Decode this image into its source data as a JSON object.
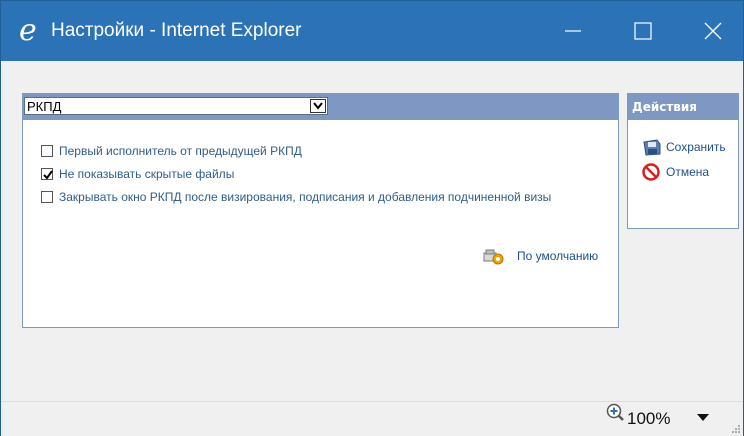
{
  "window": {
    "title": "Настройки - Internet Explorer",
    "title_icon": "ie-logo-icon",
    "controls": [
      "minimize-icon",
      "maximize-icon",
      "close-icon"
    ]
  },
  "main": {
    "select": {
      "value": "РКПД"
    },
    "options": [
      {
        "label": "Первый исполнитель от предыдущей РКПД",
        "checked": false
      },
      {
        "label": "Не показывать скрытые файлы",
        "checked": true
      },
      {
        "label": "Закрывать окно РКПД после визирования, подписания и добавления подчиненной визы",
        "checked": false
      }
    ],
    "default_link": "По умолчанию"
  },
  "actions": {
    "header": "Действия",
    "items": [
      {
        "label": "Сохранить",
        "icon": "save-icon"
      },
      {
        "label": "Отмена",
        "icon": "cancel-icon"
      }
    ]
  },
  "status": {
    "zoom": "100%",
    "zoom_icon": "zoom-in-icon"
  },
  "colors": {
    "titlebar": "#2b73b6",
    "panel_header": "#7e98c3",
    "link": "#1e4f8f",
    "option_text": "#2f5d8a"
  }
}
